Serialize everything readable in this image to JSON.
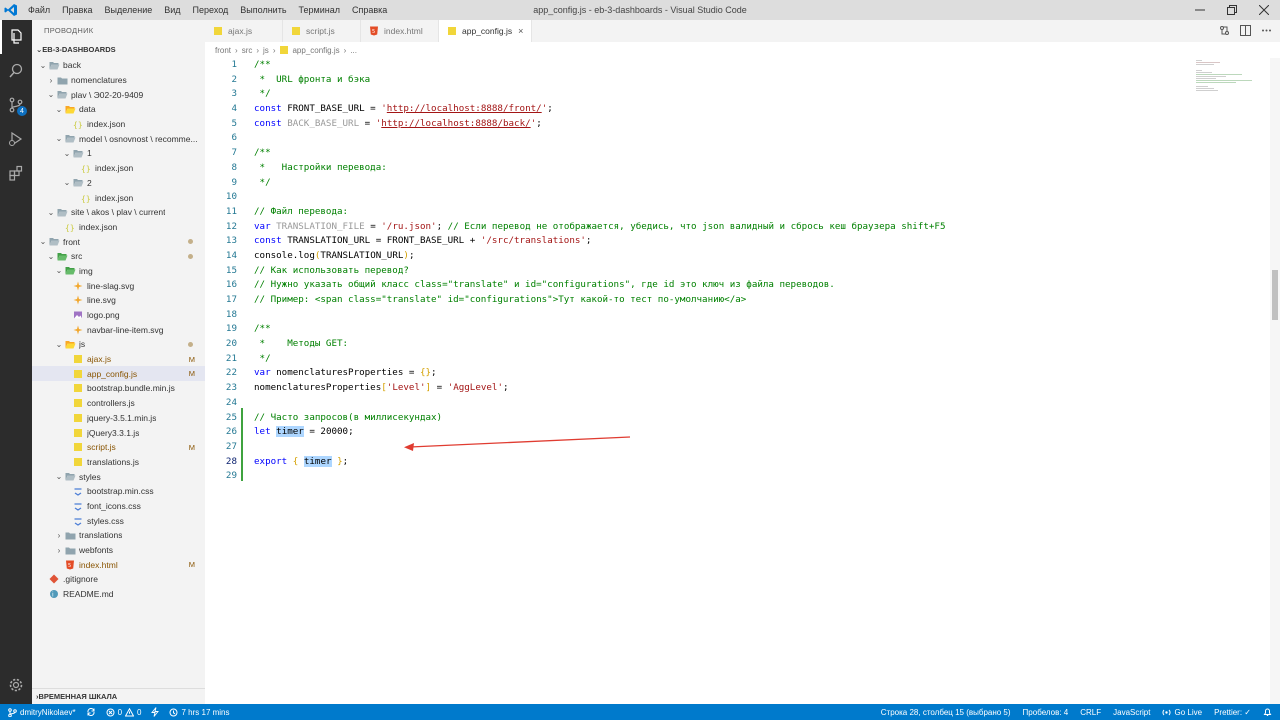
{
  "titlebar": {
    "menu": [
      "Файл",
      "Правка",
      "Выделение",
      "Вид",
      "Переход",
      "Выполнить",
      "Терминал",
      "Справка"
    ],
    "window_title": "app_config.js - eb-3-dashboards - Visual Studio Code",
    "logo_icon": "vscode-logo-icon"
  },
  "activity_bar": {
    "items": [
      "explorer-icon",
      "search-icon",
      "source-control-icon",
      "run-debug-icon",
      "extensions-icon"
    ],
    "scm_badge": "4",
    "settings_icon": "gear-icon"
  },
  "sidebar": {
    "title": "ПРОВОДНИК",
    "section": "EB-3-DASHBOARDS",
    "bottom_section": "ВРЕМЕННАЯ ШКАЛА",
    "tree": [
      {
        "label": "back",
        "type": "folder-open",
        "depth": 1
      },
      {
        "label": "nomenclatures",
        "type": "folder-closed",
        "depth": 2
      },
      {
        "label": "plav \\ Э02-20-9409",
        "type": "folder-open",
        "depth": 2
      },
      {
        "label": "data",
        "type": "folder-open-y",
        "depth": 3
      },
      {
        "label": "index.json",
        "type": "json",
        "depth": 4
      },
      {
        "label": "model \\ osnovnost \\ recomme...",
        "type": "folder-open",
        "depth": 3
      },
      {
        "label": "1",
        "type": "folder-open",
        "depth": 4
      },
      {
        "label": "index.json",
        "type": "json",
        "depth": 5
      },
      {
        "label": "2",
        "type": "folder-open",
        "depth": 4
      },
      {
        "label": "index.json",
        "type": "json",
        "depth": 5
      },
      {
        "label": "site \\ akos \\ plav \\ current",
        "type": "folder-open",
        "depth": 2
      },
      {
        "label": "index.json",
        "type": "json",
        "depth": 3
      },
      {
        "label": "front",
        "type": "folder-open",
        "depth": 1,
        "dot": true
      },
      {
        "label": "src",
        "type": "folder-open-g",
        "depth": 2,
        "dot": true
      },
      {
        "label": "img",
        "type": "folder-open-g",
        "depth": 3
      },
      {
        "label": "line-slag.svg",
        "type": "svg",
        "depth": 4
      },
      {
        "label": "line.svg",
        "type": "svg",
        "depth": 4
      },
      {
        "label": "logo.png",
        "type": "png",
        "depth": 4
      },
      {
        "label": "navbar-line-item.svg",
        "type": "svg",
        "depth": 4
      },
      {
        "label": "js",
        "type": "folder-open-y",
        "depth": 3,
        "dot": true
      },
      {
        "label": "ajax.js",
        "type": "js",
        "depth": 4,
        "badge": "M"
      },
      {
        "label": "app_config.js",
        "type": "js",
        "depth": 4,
        "badge": "M",
        "selected": true
      },
      {
        "label": "bootstrap.bundle.min.js",
        "type": "js",
        "depth": 4
      },
      {
        "label": "controllers.js",
        "type": "js",
        "depth": 4
      },
      {
        "label": "jquery-3.5.1.min.js",
        "type": "js",
        "depth": 4
      },
      {
        "label": "jQuery3.3.1.js",
        "type": "js",
        "depth": 4
      },
      {
        "label": "script.js",
        "type": "js",
        "depth": 4,
        "badge": "M"
      },
      {
        "label": "translations.js",
        "type": "js",
        "depth": 4
      },
      {
        "label": "styles",
        "type": "folder-open",
        "depth": 3
      },
      {
        "label": "bootstrap.min.css",
        "type": "css",
        "depth": 4
      },
      {
        "label": "font_icons.css",
        "type": "css",
        "depth": 4
      },
      {
        "label": "styles.css",
        "type": "css",
        "depth": 4
      },
      {
        "label": "translations",
        "type": "folder-closed",
        "depth": 3
      },
      {
        "label": "webfonts",
        "type": "folder-closed",
        "depth": 3
      },
      {
        "label": "index.html",
        "type": "html",
        "depth": 3,
        "badge": "M"
      },
      {
        "label": ".gitignore",
        "type": "git",
        "depth": 1
      },
      {
        "label": "README.md",
        "type": "md",
        "depth": 1
      }
    ]
  },
  "tabs": [
    {
      "label": "ajax.js",
      "icon": "js-file-icon",
      "active": false
    },
    {
      "label": "script.js",
      "icon": "js-file-icon",
      "active": false
    },
    {
      "label": "index.html",
      "icon": "html-file-icon",
      "active": false
    },
    {
      "label": "app_config.js",
      "icon": "js-file-icon",
      "active": true,
      "close": "×"
    }
  ],
  "breadcrumb": [
    "front",
    "src",
    "js",
    "app_config.js",
    "..."
  ],
  "editor": {
    "current_line": 28,
    "lines": [
      [
        [
          "c-com",
          "/**"
        ]
      ],
      [
        [
          "c-com",
          " *  URL фронта и бэка"
        ]
      ],
      [
        [
          "c-com",
          " */"
        ]
      ],
      [
        [
          "c-kw",
          "const"
        ],
        [
          "",
          " FRONT_BASE_URL = "
        ],
        [
          "c-str",
          "'"
        ],
        [
          "c-url",
          "http://localhost:8888/front/"
        ],
        [
          "c-str",
          "'"
        ],
        [
          "",
          ";"
        ]
      ],
      [
        [
          "c-kw",
          "const"
        ],
        [
          "c-grey",
          " BACK_BASE_URL"
        ],
        [
          "",
          " = "
        ],
        [
          "c-str",
          "'"
        ],
        [
          "c-url",
          "http://localhost:8888/back/"
        ],
        [
          "c-str",
          "'"
        ],
        [
          "",
          ";"
        ]
      ],
      [
        [
          "",
          ""
        ]
      ],
      [
        [
          "c-com",
          "/**"
        ]
      ],
      [
        [
          "c-com",
          " *   Настройки перевода:"
        ]
      ],
      [
        [
          "c-com",
          " */"
        ]
      ],
      [
        [
          "",
          ""
        ]
      ],
      [
        [
          "c-com",
          "// Файл перевода:"
        ]
      ],
      [
        [
          "c-kw",
          "var"
        ],
        [
          "c-grey",
          " TRANSLATION_FILE"
        ],
        [
          "",
          " = "
        ],
        [
          "c-str",
          "'/ru.json'"
        ],
        [
          "",
          "; "
        ],
        [
          "c-com",
          "// Если перевод не отображается, убедись, что json валидный и сбрось кеш браузера shift+F5"
        ]
      ],
      [
        [
          "c-kw",
          "const"
        ],
        [
          "",
          " TRANSLATION_URL = FRONT_BASE_URL + "
        ],
        [
          "c-str",
          "'/src/translations'"
        ],
        [
          "",
          ";"
        ]
      ],
      [
        [
          "",
          "console.log"
        ],
        [
          "c-brk",
          "("
        ],
        [
          "",
          "TRANSLATION_URL"
        ],
        [
          "c-brk",
          ")"
        ],
        [
          "",
          ";"
        ]
      ],
      [
        [
          "c-com",
          "// Как использовать перевод?"
        ]
      ],
      [
        [
          "c-com",
          "// Нужно указать общий класс class=\"translate\" и id=\"configurations\", где id это ключ из файла переводов."
        ]
      ],
      [
        [
          "c-com",
          "// Пример: <span class=\"translate\" id=\"configurations\">Тут какой-то тест по-умолчанию</a>"
        ]
      ],
      [
        [
          "",
          ""
        ]
      ],
      [
        [
          "c-com",
          "/**"
        ]
      ],
      [
        [
          "c-com",
          " *    Методы GET:"
        ]
      ],
      [
        [
          "c-com",
          " */"
        ]
      ],
      [
        [
          "c-kw",
          "var"
        ],
        [
          "",
          " nomenclaturesProperties = "
        ],
        [
          "c-brk",
          "{}"
        ],
        [
          "",
          ";"
        ]
      ],
      [
        [
          "",
          "nomenclaturesProperties"
        ],
        [
          "c-brk",
          "["
        ],
        [
          "c-str",
          "'Level'"
        ],
        [
          "c-brk",
          "]"
        ],
        [
          "",
          " = "
        ],
        [
          "c-str",
          "'AggLevel'"
        ],
        [
          "",
          ";"
        ]
      ],
      [
        [
          "",
          ""
        ]
      ],
      [
        [
          "c-com",
          "// Часто запросов(в миллисекундах)"
        ]
      ],
      [
        [
          "c-kw",
          "let"
        ],
        [
          "",
          " "
        ],
        [
          "hl",
          "timer"
        ],
        [
          "",
          " = 20000;"
        ]
      ],
      [
        [
          "",
          ""
        ]
      ],
      [
        [
          "c-kw",
          "export"
        ],
        [
          "",
          " "
        ],
        [
          "c-brk",
          "{"
        ],
        [
          "",
          " "
        ],
        [
          "hl",
          "timer"
        ],
        [
          "",
          " "
        ],
        [
          "c-brk",
          "}"
        ],
        [
          "",
          ";"
        ]
      ],
      [
        [
          "",
          ""
        ]
      ]
    ]
  },
  "statusbar": {
    "branch": "dmitryNikolaev*",
    "sync_icon": "sync-icon",
    "problems": "0",
    "warnings": "0",
    "wakatime": "7 hrs 17 mins",
    "cursor": "Строка 28, столбец 15 (выбрано 5)",
    "spaces": "Пробелов: 4",
    "eol": "CRLF",
    "language": "JavaScript",
    "golive": "Go Live",
    "prettier": "Prettier: ✓"
  },
  "annotation": {
    "color": "#e03c31"
  }
}
